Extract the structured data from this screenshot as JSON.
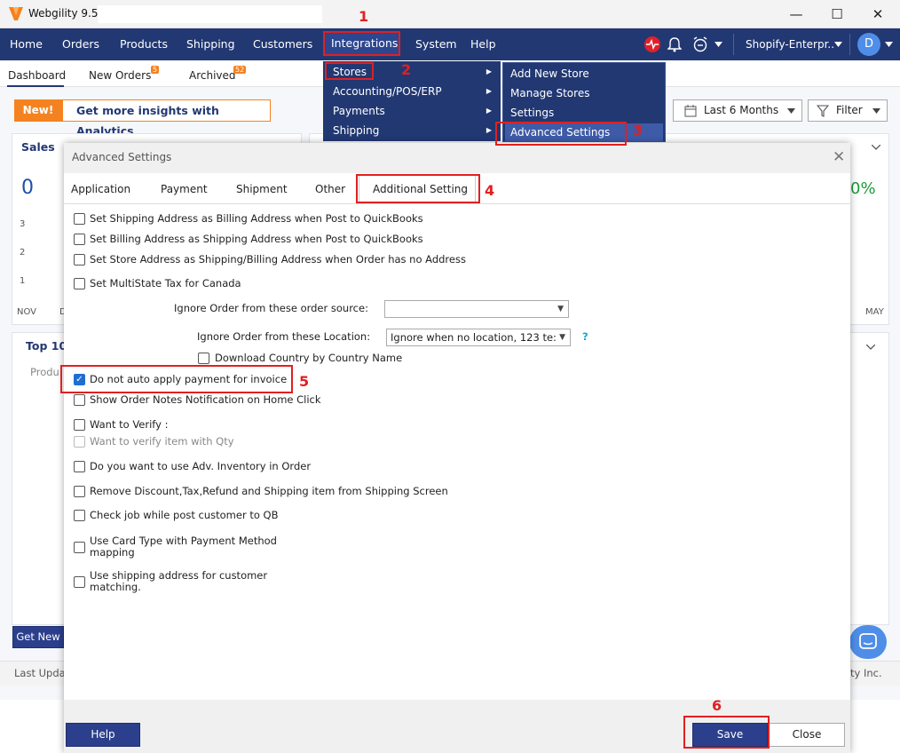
{
  "window": {
    "title": "Webgility 9.5",
    "minimize": "—",
    "maximize": "☐",
    "close": "✕"
  },
  "menubar": {
    "items": [
      "Home",
      "Orders",
      "Products",
      "Shipping",
      "Customers",
      "Integrations",
      "System",
      "Help"
    ],
    "store_selector": "Shopify-Enterpr..",
    "avatar_initial": "D"
  },
  "subtabs": {
    "dashboard": "Dashboard",
    "new_orders": "New Orders",
    "new_orders_badge": "5",
    "archived": "Archived",
    "archived_badge": "52"
  },
  "dashboard": {
    "new_tag": "New!",
    "analytics_link": "Get more insights with Analytics",
    "date_range": "Last 6 Months",
    "filter": "Filter",
    "sales_title": "Sales",
    "sales_value": "0",
    "percent_value": "0%",
    "y_ticks": [
      "3",
      "2",
      "1"
    ],
    "x_start": "NOV",
    "x_mid": "D",
    "x_end": "MAY",
    "top_title": "Top 10",
    "product_col": "Produ",
    "get_new_btn": "Get New",
    "last_updated": "Last Upda",
    "copyright": "ty Inc."
  },
  "integrations_menu": {
    "items": [
      "Stores",
      "Accounting/POS/ERP",
      "Payments",
      "Shipping"
    ]
  },
  "stores_submenu": {
    "items": [
      "Add New Store",
      "Manage Stores",
      "Settings",
      "Advanced Settings"
    ]
  },
  "annotations": [
    "1",
    "2",
    "3",
    "4",
    "5",
    "6"
  ],
  "dialog": {
    "title": "Advanced Settings",
    "close": "✕",
    "tabs": [
      "Application",
      "Payment",
      "Shipment",
      "Other",
      "Additional Setting"
    ],
    "options": {
      "ship_as_bill": "Set Shipping Address as Billing Address when Post to QuickBooks",
      "bill_as_ship": "Set Billing Address as Shipping Address when Post to QuickBooks",
      "store_addr": "Set Store Address as Shipping/Billing Address when Order has no Address",
      "multistate_tax": "Set MultiState Tax for Canada",
      "ignore_source_label": "Ignore Order from these order source:",
      "ignore_source_value": "",
      "ignore_location_label": "Ignore Order from these  Location:",
      "ignore_location_value": "Ignore when no location, 123 te:",
      "help_mark": "?",
      "download_country": "Download Country by Country Name",
      "no_auto_payment": "Do not auto apply payment for invoice",
      "order_notes": "Show Order Notes Notification on Home Click",
      "want_verify": "Want to Verify :",
      "verify_qty": "Want to verify item with Qty",
      "adv_inventory": "Do you want to use Adv. Inventory in Order",
      "remove_discount": "Remove Discount,Tax,Refund and Shipping item from Shipping Screen",
      "check_job": "Check job while post customer to QB",
      "card_type_line1": "Use Card Type with Payment Method",
      "card_type_line2": "mapping",
      "ship_addr_line1": "Use shipping address for customer",
      "ship_addr_line2": "matching."
    },
    "buttons": {
      "help": "Help",
      "save": "Save",
      "close": "Close"
    }
  }
}
